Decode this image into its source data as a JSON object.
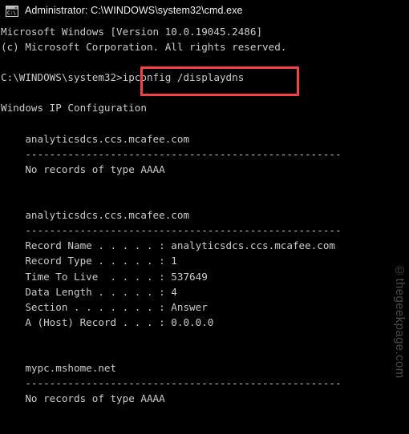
{
  "window": {
    "title": "Administrator: C:\\WINDOWS\\system32\\cmd.exe",
    "icon": "console-window-icon",
    "background_color": "#000000",
    "text_color": "#c9cbcb"
  },
  "console": {
    "lines": [
      "Microsoft Windows [Version 10.0.19045.2486]",
      "(c) Microsoft Corporation. All rights reserved.",
      "",
      "C:\\WINDOWS\\system32>ipconfig /displaydns",
      "",
      "Windows IP Configuration",
      "",
      "    analyticsdcs.ccs.mcafee.com",
      "    ----------------------------------------------------",
      "    No records of type AAAA",
      "",
      "",
      "    analyticsdcs.ccs.mcafee.com",
      "    ----------------------------------------------------",
      "    Record Name . . . . . : analyticsdcs.ccs.mcafee.com",
      "    Record Type . . . . . : 1",
      "    Time To Live  . . . . : 537649",
      "    Data Length . . . . . : 4",
      "    Section . . . . . . . : Answer",
      "    A (Host) Record . . . : 0.0.0.0",
      "",
      "",
      "    mypc.mshome.net",
      "    ----------------------------------------------------",
      "    No records of type AAAA"
    ],
    "prompt": "C:\\WINDOWS\\system32>",
    "command": "ipconfig /displaydns"
  },
  "highlight": {
    "target_text": "ipconfig /displaydns",
    "color": "#f94144"
  },
  "watermark": {
    "text": "©thegeekpage.com",
    "color": "#4a4a4a"
  }
}
